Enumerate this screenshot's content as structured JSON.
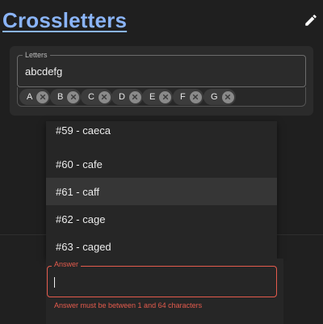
{
  "header": {
    "title": "Crossletters",
    "edit_icon": "pencil-icon"
  },
  "letters": {
    "label": "Letters",
    "value": "abcdefg",
    "chips": [
      {
        "label": "A"
      },
      {
        "label": "B"
      },
      {
        "label": "C"
      },
      {
        "label": "D"
      },
      {
        "label": "E"
      },
      {
        "label": "F"
      },
      {
        "label": "G"
      }
    ]
  },
  "options": [
    {
      "label": "#59 - caeca"
    },
    {
      "label": "#60 - cafe"
    },
    {
      "label": "#61 - caff",
      "active": true
    },
    {
      "label": "#62 - cage"
    },
    {
      "label": "#63 - caged"
    }
  ],
  "answer": {
    "label": "Answer",
    "value": "",
    "error": "Answer must be between 1 and 64 characters"
  },
  "colors": {
    "accent": "#8ab4f8",
    "error": "#e55b4d",
    "background": "#1f1f1f"
  }
}
